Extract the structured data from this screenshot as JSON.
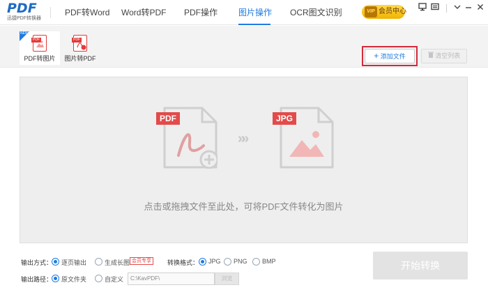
{
  "logo": {
    "text": "PDF",
    "subtitle": "迅捷PDF转换器"
  },
  "nav": {
    "tabs": [
      {
        "label": "PDF转Word"
      },
      {
        "label": "Word转PDF"
      },
      {
        "label": "PDF操作"
      },
      {
        "label": "图片操作",
        "active": true
      },
      {
        "label": "OCR图文识别"
      }
    ]
  },
  "header_right": {
    "vip_label": "会员中心",
    "vip_badge": "VIP",
    "icons": [
      "monitor-icon",
      "message-icon",
      "dropdown-icon",
      "minimize-icon",
      "close-icon"
    ]
  },
  "subtabs": [
    {
      "label": "PDF转图片",
      "active": true,
      "doc_tag": "PDF",
      "corner": "NEW"
    },
    {
      "label": "图片转PDF",
      "active": false,
      "doc_tag": "PDF"
    }
  ],
  "toolbar": {
    "add_file": "添加文件",
    "clear_list": "清空列表"
  },
  "dropzone": {
    "hint": "点击或拖拽文件至此处，可将PDF文件转化为图片",
    "source_tag": "PDF",
    "target_tag": "JPG",
    "arrows": "»"
  },
  "options": {
    "output_mode_label": "输出方式：",
    "mode_page": "逐页输出",
    "mode_long": "生成长图",
    "vip_only": "会员专享",
    "format_label": "转换格式：",
    "formats": [
      "JPG",
      "PNG",
      "BMP"
    ],
    "path_label": "输出路径：",
    "path_original": "原文件夹",
    "path_custom": "自定义",
    "path_value": "C:\\KavPDF\\",
    "browse": "浏览"
  },
  "start_button": "开始转换",
  "colors": {
    "accent": "#1e7be0",
    "pdf_red": "#e34a4a",
    "highlight_outline": "#d32a3a"
  }
}
